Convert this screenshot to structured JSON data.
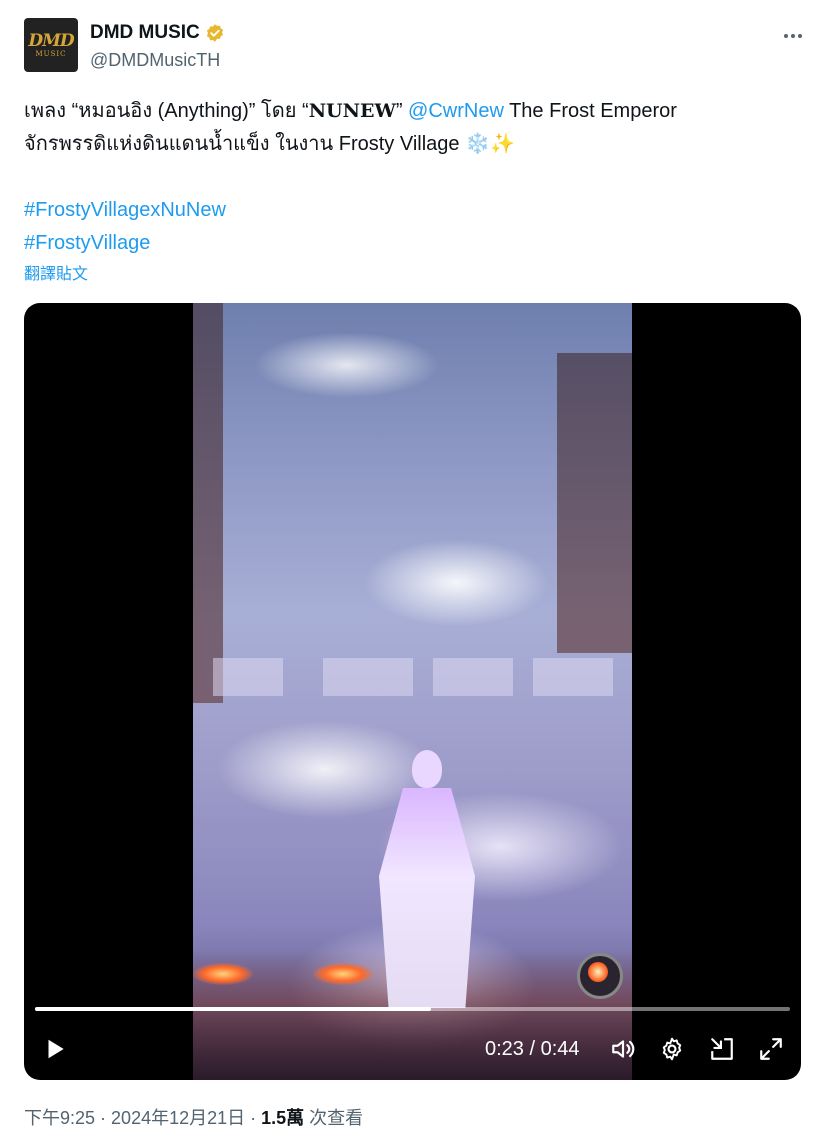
{
  "author": {
    "avatar_logo_top": "DMD",
    "avatar_logo_bottom": "MUSIC",
    "display_name": "DMD MUSIC",
    "handle": "@DMDMusicTH",
    "verified_color": "#e8b72f"
  },
  "tweet": {
    "line1_a": "เพลง “หมอนอิง (Anything)” โดย “",
    "line1_nunew": "NUNEW",
    "line1_b": "” ",
    "line1_mention": "@CwrNew",
    "line1_c": " The Frost Emperor",
    "line2": "จักรพรรดิแห่งดินแดนน้ำแข็ง ในงาน Frosty Village ❄️✨",
    "hashtag1": "#FrostyVillagexNuNew",
    "hashtag2": "#FrostyVillage",
    "translate_label": "翻譯貼文"
  },
  "video": {
    "progress_fraction": 0.524,
    "time_display": "0:23 / 0:44",
    "icons": [
      "play-icon",
      "volume-icon",
      "settings-icon",
      "minimize-icon",
      "fullscreen-icon"
    ]
  },
  "footer": {
    "time": "下午9:25",
    "sep1": " · ",
    "date": "2024年12月21日",
    "sep2": " · ",
    "views_count": "1.5萬",
    "views_label": " 次查看"
  },
  "colors": {
    "link": "#1d9bf0",
    "secondary_text": "#536471",
    "primary_text": "#0f1419"
  }
}
